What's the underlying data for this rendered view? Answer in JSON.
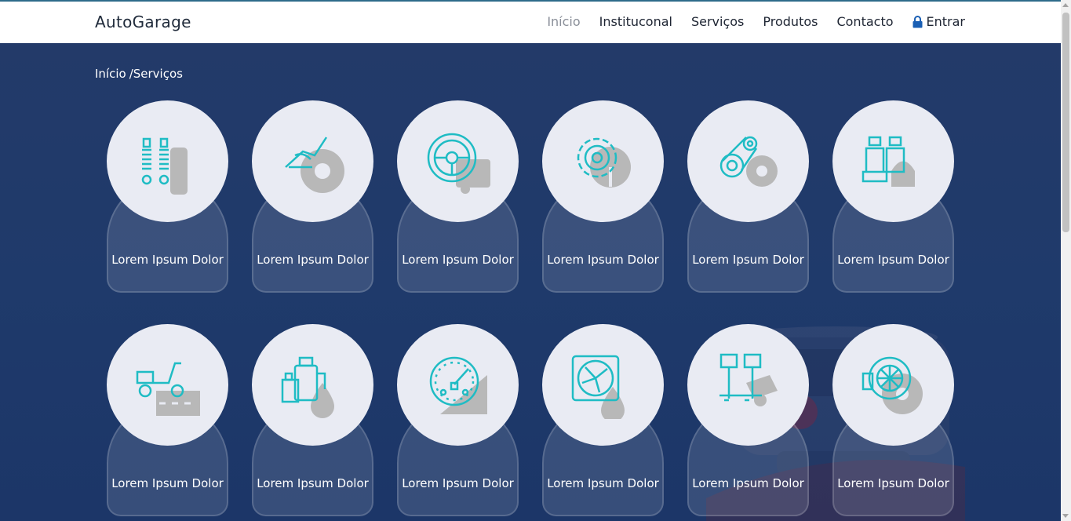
{
  "brand": "AutoGarage",
  "nav": {
    "items": [
      {
        "label": "Início",
        "active": true
      },
      {
        "label": "Instituconal",
        "active": false
      },
      {
        "label": "Serviços",
        "active": false
      },
      {
        "label": "Produtos",
        "active": false
      },
      {
        "label": "Contacto",
        "active": false
      }
    ],
    "login_label": "Entrar"
  },
  "breadcrumb": {
    "home": "Início",
    "separator": "/",
    "current": "Serviços"
  },
  "colors": {
    "accent": "#1fbcc4",
    "gray": "#b8b8b8",
    "bg": "#1f3a6a"
  },
  "services": [
    {
      "label": "Lorem Ipsum Dolor",
      "icon": "shock-absorber-icon"
    },
    {
      "label": "Lorem Ipsum Dolor",
      "icon": "car-seat-brake-icon"
    },
    {
      "label": "Lorem Ipsum Dolor",
      "icon": "steering-wheel-icon"
    },
    {
      "label": "Lorem Ipsum Dolor",
      "icon": "gear-icon"
    },
    {
      "label": "Lorem Ipsum Dolor",
      "icon": "timing-belt-icon"
    },
    {
      "label": "Lorem Ipsum Dolor",
      "icon": "seats-icon"
    },
    {
      "label": "Lorem Ipsum Dolor",
      "icon": "scooter-icon"
    },
    {
      "label": "Lorem Ipsum Dolor",
      "icon": "oil-can-icon"
    },
    {
      "label": "Lorem Ipsum Dolor",
      "icon": "speedometer-icon"
    },
    {
      "label": "Lorem Ipsum Dolor",
      "icon": "radiator-fan-icon"
    },
    {
      "label": "Lorem Ipsum Dolor",
      "icon": "pistons-icon"
    },
    {
      "label": "Lorem Ipsum Dolor",
      "icon": "turbo-icon"
    }
  ]
}
